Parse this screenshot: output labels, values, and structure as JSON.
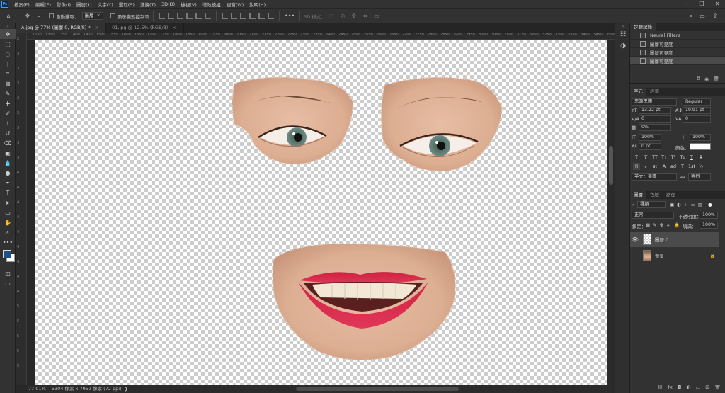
{
  "app": {
    "logo": "Ps"
  },
  "menu": [
    "檔案(F)",
    "編輯(E)",
    "影像(I)",
    "圖層(L)",
    "文字(Y)",
    "選取(S)",
    "濾鏡(T)",
    "3D(D)",
    "檢視(V)",
    "增效模組",
    "視窗(W)",
    "說明(H)"
  ],
  "options": {
    "auto_select_label": "自動選取：",
    "auto_select_value": "圖層",
    "show_transform_label": "顯示變形控制項",
    "more": "•••",
    "mode_3d": "3D 模式："
  },
  "tabs": [
    {
      "label": "A.jpg @ 77% (圖層 0, RGB/8) *",
      "close": "×"
    },
    {
      "label": "01.jpg @ 12.5% (RGB/8)",
      "close": "×"
    }
  ],
  "ruler_top_ticks": [
    "1250",
    "1300",
    "1350",
    "1400",
    "1450",
    "1500",
    "1550",
    "1600",
    "1650",
    "1700",
    "1750",
    "1800",
    "1850",
    "1900",
    "1950",
    "2000",
    "2050",
    "2100",
    "2150",
    "2200",
    "2250",
    "2300",
    "2350",
    "2400",
    "2450",
    "2500",
    "2550",
    "2600",
    "2650",
    "2700",
    "2750",
    "2800",
    "2850",
    "2900",
    "2950",
    "3000",
    "3050",
    "3100",
    "3150",
    "3200",
    "3250",
    "3300",
    "3350",
    "3400",
    "3450",
    "3500"
  ],
  "ruler_left_ticks": [
    "2",
    "3",
    "3",
    "3",
    "3",
    "3",
    "3",
    "3",
    "3",
    "4",
    "4",
    "4",
    "4",
    "4",
    "4",
    "4",
    "4",
    "4",
    "5",
    "5",
    "5",
    "5",
    "5"
  ],
  "status": {
    "zoom": "77.01%",
    "doc_info": "5304 像素 x 7952 像素 (72 ppi)"
  },
  "history": {
    "tab": "步驟記錄",
    "items": [
      "Neural Filters",
      "圖層可見度",
      "圖層可見度",
      "圖層可見度"
    ],
    "selected_index": 3
  },
  "character": {
    "tabs": [
      "字元",
      "段落"
    ],
    "font_family": "思源黑體",
    "font_style": "Regular",
    "size": "13.22 pt",
    "leading": "19.91 pt",
    "kerning": "0",
    "tracking": "0",
    "vscale_pct": "0%",
    "scale_v": "100%",
    "scale_h": "100%",
    "baseline": "0 pt",
    "color_label": "顏色：",
    "type_buttons": [
      "T",
      "T",
      "TT",
      "Tт",
      "T¹",
      "T₁",
      "T",
      "T"
    ],
    "opentype_buttons": [
      "fi",
      "ℴ",
      "st",
      "A",
      "ad",
      "T",
      "1st",
      "½"
    ],
    "language": "英文：美國",
    "antialias": "強烈",
    "aa_icon": "aa"
  },
  "layers": {
    "tabs": [
      "圖層",
      "色版",
      "路徑"
    ],
    "filter_label": "種類",
    "blend_mode": "正常",
    "opacity_label": "不透明度：",
    "opacity": "100%",
    "lock_label": "鎖定：",
    "fill_label": "填滿：",
    "fill": "100%",
    "items": [
      {
        "name": "圖層 0",
        "visible": true,
        "selected": true
      },
      {
        "name": "背景",
        "visible": false,
        "selected": false,
        "locked": true
      }
    ],
    "footer_icons": [
      "link-icon",
      "fx-icon",
      "mask-icon",
      "adjustment-icon",
      "group-icon",
      "new-layer-icon",
      "trash-icon"
    ]
  },
  "colors": {
    "foreground": "#1d4f8a",
    "background": "#ffffff",
    "accent": "#31a8ff"
  }
}
